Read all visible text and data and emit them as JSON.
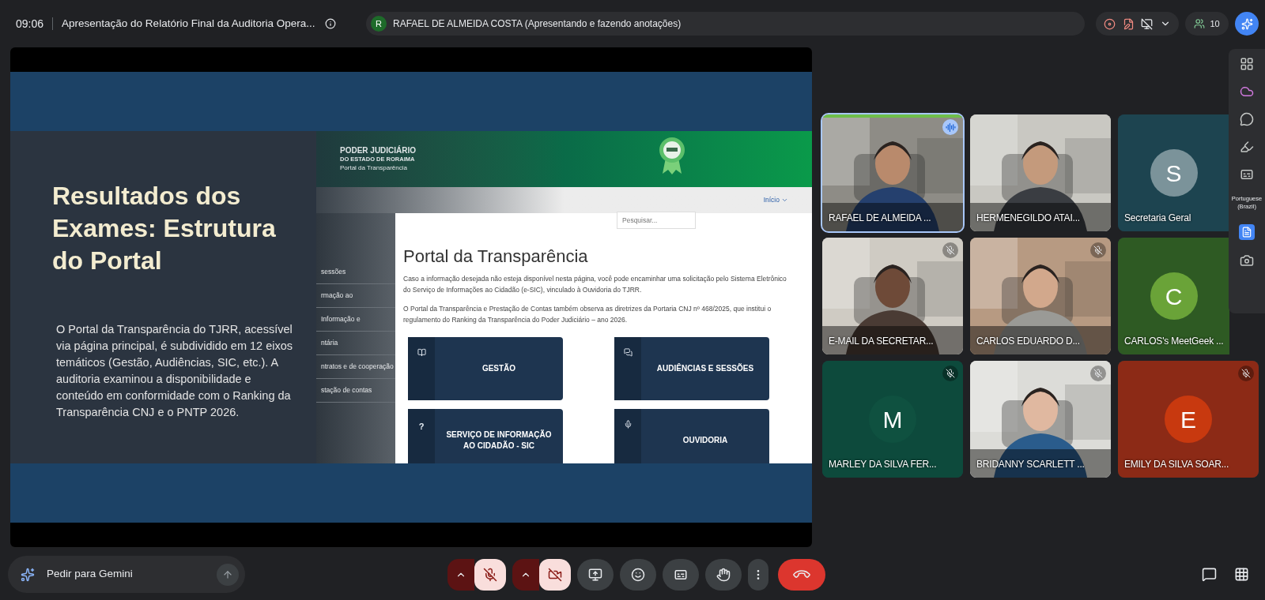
{
  "top_bar": {
    "time": "09:06",
    "meeting_title": "Apresentação do Relatório Final da Auditoria Opera...",
    "presenter": {
      "initial": "R",
      "label": "RAFAEL DE ALMEIDA COSTA (Apresentando e fazendo anotações)"
    },
    "participant_count": "10"
  },
  "slide": {
    "title": "Resultados dos Exames: Estrutura do Portal",
    "body": "O Portal da Transparência do TJRR, acessível via página principal, é subdividido em 12 eixos temáticos (Gestão, Audiências, SIC, etc.). A auditoria examinou a disponibilidade e conteúdo em conformidade com o Ranking da Transparência CNJ e o PNTP 2026.",
    "screenshot": {
      "logo_lines": [
        "PODER JUDICIÁRIO",
        "DO ESTADO DE RORAIMA",
        "Portal da Transparência"
      ],
      "nav_link": "Início",
      "search": {
        "placeholder": "Pesquisar..."
      },
      "sidebar_items": [
        "sessões",
        "rmação ao",
        "Informação e",
        "ntária",
        "ntratos e de cooperação",
        "stação de contas"
      ],
      "heading": "Portal da Transparência",
      "paragraphs": [
        "Caso a informação desejada não esteja disponível nesta página, você pode encaminhar uma solicitação pelo Sistema Eletrônico do Serviço de Informações ao Cidadão (e-SIC), vinculado à Ouvidoria do TJRR.",
        "O Portal da Transparência e Prestação de Contas também observa as diretrizes da Portaria CNJ nº 468/2025, que institui o regulamento do Ranking da Transparência do Poder Judiciário – ano 2026."
      ],
      "cards": [
        {
          "kind": "book",
          "label": "GESTÃO"
        },
        {
          "kind": "chat",
          "label": "AUDIÊNCIAS E SESSÕES"
        },
        {
          "kind": "symbol",
          "symbol": "?",
          "label": "SERVIÇO DE INFORMAÇÃO AO CIDADÃO - SIC"
        },
        {
          "kind": "mic",
          "label": "OUVIDORIA"
        }
      ]
    }
  },
  "participants": [
    {
      "name": "RAFAEL DE ALMEIDA ...",
      "kind": "video",
      "muted": false,
      "speaking": true
    },
    {
      "name": "HERMENEGILDO ATAI...",
      "kind": "video",
      "muted": false,
      "speaking": false
    },
    {
      "name": "Secretaria Geral",
      "kind": "avatar",
      "initial": "S",
      "color": "#7b939a",
      "muted": false,
      "speaking": false
    },
    {
      "name": "E-MAIL DA SECRETAR...",
      "kind": "video",
      "muted": true,
      "speaking": false
    },
    {
      "name": "CARLOS EDUARDO D...",
      "kind": "video",
      "muted": true,
      "speaking": false
    },
    {
      "name": "CARLOS's MeetGeek ...",
      "kind": "avatar",
      "initial": "C",
      "color": "#6aa338",
      "muted": false,
      "speaking": false
    },
    {
      "name": "MARLEY DA SILVA FER...",
      "kind": "avatar",
      "initial": "M",
      "color": "#0f5140",
      "muted": true,
      "speaking": false
    },
    {
      "name": "BRIDANNY SCARLETT ...",
      "kind": "video",
      "muted": true,
      "speaking": false
    },
    {
      "name": "EMILY DA SILVA SOAR...",
      "kind": "avatar",
      "initial": "E",
      "color": "#c8390f",
      "muted": true,
      "speaking": false
    }
  ],
  "side_panel": {
    "language": "Portuguese (Brazil)"
  },
  "gemini": {
    "placeholder": "Pedir para Gemini"
  },
  "controls": {
    "mic": {
      "on": false
    },
    "camera": {
      "on": false
    }
  }
}
